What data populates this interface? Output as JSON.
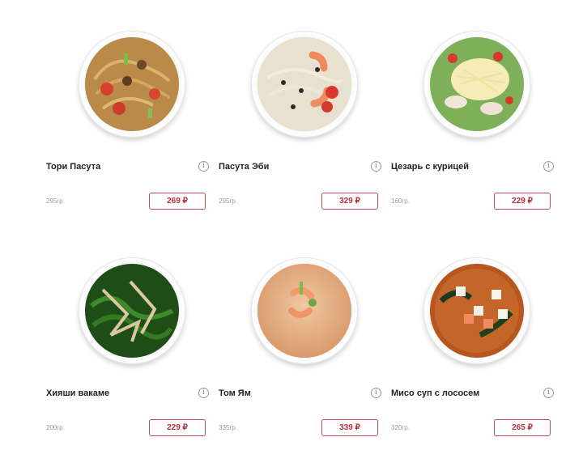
{
  "products": [
    {
      "name": "Тори Пасута",
      "weight": "295гр.",
      "price": "269 ₽",
      "info_icon": "i"
    },
    {
      "name": "Пасута Эби",
      "weight": "295гр.",
      "price": "329 ₽",
      "info_icon": "i"
    },
    {
      "name": "Цезарь с курицей",
      "weight": "160гр.",
      "price": "229 ₽",
      "info_icon": "i"
    },
    {
      "name": "Хияши вакаме",
      "weight": "200гр.",
      "price": "229 ₽",
      "info_icon": "i"
    },
    {
      "name": "Том Ям",
      "weight": "335гр.",
      "price": "339 ₽",
      "info_icon": "i"
    },
    {
      "name": "Мисо суп с лососем",
      "weight": "320гр.",
      "price": "265 ₽",
      "info_icon": "i"
    }
  ],
  "colors": {
    "accent": "#b5303e",
    "price_border": "#c24a57",
    "muted": "#9a9a9a"
  }
}
